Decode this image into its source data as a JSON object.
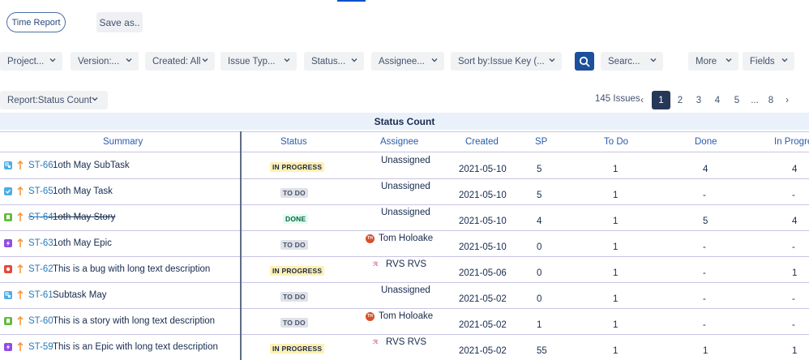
{
  "toolbar": {
    "time_report_label": "Time Report",
    "save_as_label": "Save as.."
  },
  "filters": [
    {
      "label": "Project..."
    },
    {
      "label": "Version:..."
    },
    {
      "label": "Created: All"
    },
    {
      "label": "Issue Typ..."
    },
    {
      "label": "Status..."
    },
    {
      "label": "Assignee..."
    },
    {
      "label": "Sort by:Issue Key (..."
    },
    {
      "label": "Searc..."
    },
    {
      "label": "More"
    },
    {
      "label": "Fields"
    }
  ],
  "report": {
    "selector_label": "Report:Status Count",
    "title": "Status Count"
  },
  "pagination": {
    "issues_count": "145 Issues",
    "prev": "‹",
    "pages": [
      "1",
      "2",
      "3",
      "4",
      "5",
      "...",
      "8"
    ],
    "next": "›",
    "current": "1"
  },
  "table": {
    "columns": [
      "Summary",
      "Status",
      "Assignee",
      "Created",
      "SP",
      "To Do",
      "Done",
      "In Progress"
    ],
    "rows": [
      {
        "type": "subtask",
        "key": "ST-66",
        "summary": "1oth May SubTask",
        "status": "IN PROGRESS",
        "status_kind": "progress",
        "assignee": "Unassigned",
        "avatar": "none",
        "created": "2021-05-10",
        "sp": "5",
        "todo": "1",
        "done": "4",
        "in_progress": "4",
        "strike": false
      },
      {
        "type": "task",
        "key": "ST-65",
        "summary": "1oth May Task",
        "status": "TO DO",
        "status_kind": "todo",
        "assignee": "Unassigned",
        "avatar": "none",
        "created": "2021-05-10",
        "sp": "5",
        "todo": "1",
        "done": "-",
        "in_progress": "-",
        "strike": false
      },
      {
        "type": "story",
        "key": "ST-64",
        "summary": "1oth May Story",
        "status": "DONE",
        "status_kind": "done",
        "assignee": "Unassigned",
        "avatar": "none",
        "created": "2021-05-10",
        "sp": "4",
        "todo": "1",
        "done": "5",
        "in_progress": "4",
        "strike": true
      },
      {
        "type": "epic",
        "key": "ST-63",
        "summary": "1oth May Epic",
        "status": "TO DO",
        "status_kind": "todo",
        "assignee": "Tom Holoake",
        "avatar": "TH",
        "created": "2021-05-10",
        "sp": "0",
        "todo": "1",
        "done": "-",
        "in_progress": "-",
        "strike": false
      },
      {
        "type": "bug",
        "key": "ST-62",
        "summary": "This is a bug with long text description",
        "status": "IN PROGRESS",
        "status_kind": "progress",
        "assignee": "RVS RVS",
        "avatar": "rvs",
        "created": "2021-05-06",
        "sp": "0",
        "todo": "1",
        "done": "-",
        "in_progress": "1",
        "strike": false
      },
      {
        "type": "subtask",
        "key": "ST-61",
        "summary": "Subtask May",
        "status": "TO DO",
        "status_kind": "todo",
        "assignee": "Unassigned",
        "avatar": "none",
        "created": "2021-05-02",
        "sp": "0",
        "todo": "1",
        "done": "-",
        "in_progress": "-",
        "strike": false
      },
      {
        "type": "story",
        "key": "ST-60",
        "summary": "This is a story with long text description",
        "status": "TO DO",
        "status_kind": "todo",
        "assignee": "Tom Holoake",
        "avatar": "TH",
        "created": "2021-05-02",
        "sp": "1",
        "todo": "1",
        "done": "-",
        "in_progress": "-",
        "strike": false
      },
      {
        "type": "epic",
        "key": "ST-59",
        "summary": "This is an Epic with long text description",
        "status": "IN PROGRESS",
        "status_kind": "progress",
        "assignee": "RVS RVS",
        "avatar": "rvs",
        "created": "2021-05-02",
        "sp": "55",
        "todo": "1",
        "done": "1",
        "in_progress": "1",
        "strike": false
      }
    ]
  },
  "colors": {
    "subtask": "#4bade8",
    "task": "#4bade8",
    "story": "#63ba3c",
    "epic": "#904ee2",
    "bug": "#e5493a",
    "priority": "#f79232",
    "link": "#2a7ab8",
    "primary": "#1c4f9c"
  },
  "icons": {
    "priority": "arrow-up-icon",
    "search": "search-icon",
    "chevron": "chevron-down-icon"
  }
}
